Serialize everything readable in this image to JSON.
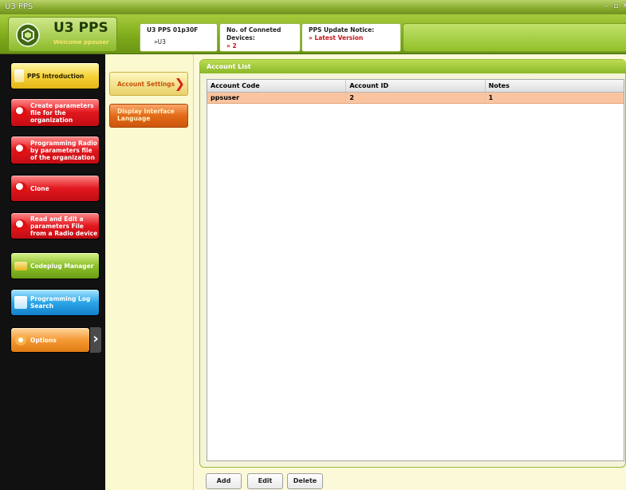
{
  "window": {
    "title": "U3 PPS",
    "controls": [
      "minimize-icon",
      "restore-icon",
      "close-icon"
    ]
  },
  "header": {
    "app_name": "U3 PPS",
    "welcome": "Welcome  ppsuser",
    "version_box": {
      "label": "U3 PPS 01p30F",
      "value": "»U3"
    },
    "devices_box": {
      "label": "No. of Conneted Devices:",
      "value": "» 2"
    },
    "update_box": {
      "label": "PPS Update Notice:",
      "value": "» Latest Version"
    }
  },
  "left_nav": {
    "items": [
      {
        "label": "PPS Introduction",
        "icon": "document-icon"
      },
      {
        "label": "Create parameters file for the organization",
        "icon": "radio-icon"
      },
      {
        "label": "Programming Radio by parameters file of the organization",
        "icon": "radio-icon"
      },
      {
        "label": "Clone",
        "icon": "radio-icon"
      },
      {
        "label": "Read and Edit a parameters File from a Radio device",
        "icon": "radio-icon"
      },
      {
        "label": "Codeplug Manager",
        "icon": "folder-icon"
      },
      {
        "label": "Programming Log Search",
        "icon": "log-icon"
      },
      {
        "label": "Options",
        "icon": "gear-icon"
      }
    ],
    "selected": "Options"
  },
  "sub_nav": {
    "items": [
      {
        "label": "Account Settings"
      },
      {
        "label": "Display Interface Language"
      }
    ],
    "selected": "Account Settings"
  },
  "account_list": {
    "title": "Account List",
    "columns": [
      "Account Code",
      "Account ID",
      "Notes"
    ],
    "rows": [
      {
        "code": "ppsuser",
        "id": "2",
        "notes": "1"
      }
    ]
  },
  "actions": {
    "add": "Add",
    "edit": "Edit",
    "delete": "Delete"
  },
  "colors": {
    "accent_green": "#8ab826",
    "selected_row": "#fbc4a0",
    "nav_bg": "#111111"
  }
}
